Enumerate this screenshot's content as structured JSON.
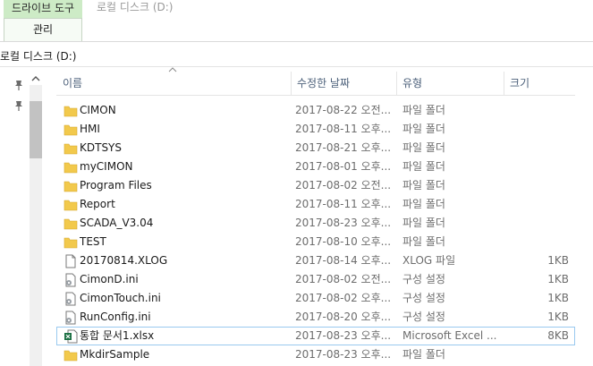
{
  "ribbon": {
    "context_tab_header": "드라이브 도구",
    "context_tab": "관리",
    "window_title": "로컬 디스크 (D:)"
  },
  "address": {
    "path": "로컬 디스크 (D:)"
  },
  "columns": {
    "name": "이름",
    "date": "수정한 날짜",
    "type": "유형",
    "size": "크기"
  },
  "colors": {
    "folder": "#f2c94c",
    "selection_border": "#99c9ef",
    "context_tab": "#cdebc6",
    "excel": "#1d7044"
  },
  "files": [
    {
      "name": "CIMON",
      "date": "2017-08-22 오전...",
      "type": "파일 폴더",
      "size": "",
      "icon": "folder-icon"
    },
    {
      "name": "HMI",
      "date": "2017-08-11 오후...",
      "type": "파일 폴더",
      "size": "",
      "icon": "folder-icon"
    },
    {
      "name": "KDTSYS",
      "date": "2017-08-21 오후...",
      "type": "파일 폴더",
      "size": "",
      "icon": "folder-icon"
    },
    {
      "name": "myCIMON",
      "date": "2017-08-01 오후...",
      "type": "파일 폴더",
      "size": "",
      "icon": "folder-icon"
    },
    {
      "name": "Program Files",
      "date": "2017-08-02 오전...",
      "type": "파일 폴더",
      "size": "",
      "icon": "folder-icon"
    },
    {
      "name": "Report",
      "date": "2017-08-11 오후...",
      "type": "파일 폴더",
      "size": "",
      "icon": "folder-icon"
    },
    {
      "name": "SCADA_V3.04",
      "date": "2017-08-23 오후...",
      "type": "파일 폴더",
      "size": "",
      "icon": "folder-icon"
    },
    {
      "name": "TEST",
      "date": "2017-08-10 오후...",
      "type": "파일 폴더",
      "size": "",
      "icon": "folder-icon"
    },
    {
      "name": "20170814.XLOG",
      "date": "2017-08-14 오후...",
      "type": "XLOG 파일",
      "size": "1KB",
      "icon": "file-icon"
    },
    {
      "name": "CimonD.ini",
      "date": "2017-08-02 오전...",
      "type": "구성 설정",
      "size": "1KB",
      "icon": "config-file-icon"
    },
    {
      "name": "CimonTouch.ini",
      "date": "2017-08-02 오후...",
      "type": "구성 설정",
      "size": "1KB",
      "icon": "config-file-icon"
    },
    {
      "name": "RunConfig.ini",
      "date": "2017-08-20 오후...",
      "type": "구성 설정",
      "size": "1KB",
      "icon": "config-file-icon"
    },
    {
      "name": "통합 문서1.xlsx",
      "date": "2017-08-23 오후...",
      "type": "Microsoft Excel ...",
      "size": "8KB",
      "icon": "excel-file-icon",
      "selected": true
    },
    {
      "name": "MkdirSample",
      "date": "2017-08-23 오후...",
      "type": "파일 폴더",
      "size": "",
      "icon": "folder-icon"
    }
  ]
}
